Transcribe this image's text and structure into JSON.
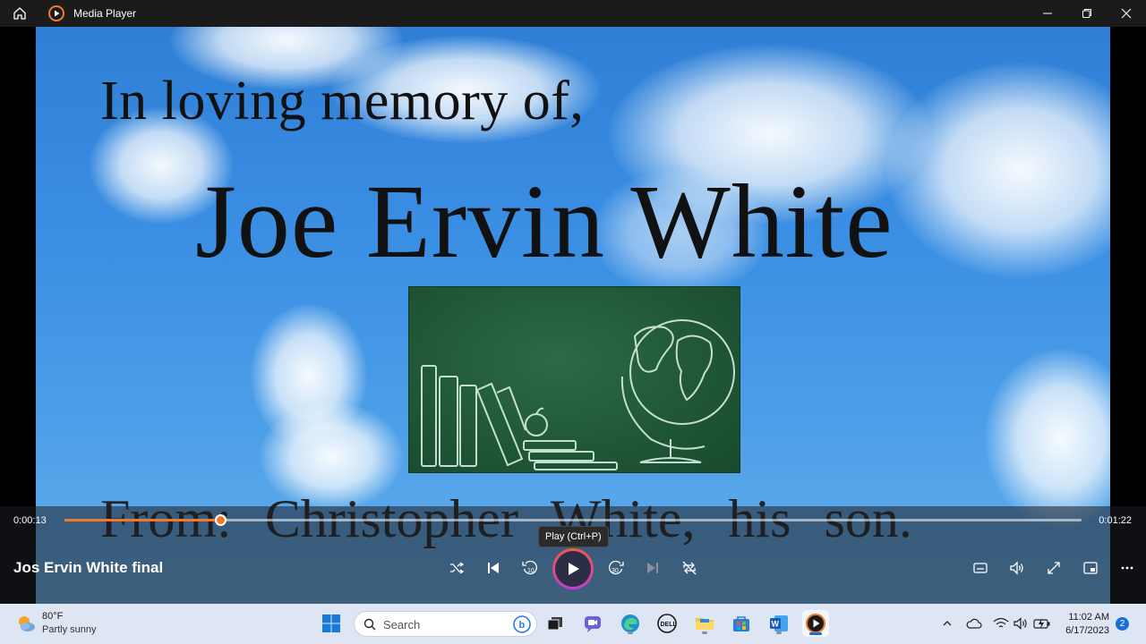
{
  "window": {
    "title": "Media Player"
  },
  "video": {
    "caption_line1": "In loving memory of,",
    "caption_line2": "Joe Ervin White",
    "caption_line3": "From:     Christopher White, his son."
  },
  "playback": {
    "current_time": "0:00:13",
    "total_time": "0:01:22",
    "progress_fraction": 0.153,
    "tooltip": "Play (Ctrl+P)",
    "media_title": "Jos Ervin White final"
  },
  "taskbar": {
    "weather_temp": "80°F",
    "weather_desc": "Partly sunny",
    "search_placeholder": "Search",
    "time": "11:02 AM",
    "date": "6/17/2023",
    "notification_count": "2"
  },
  "colors": {
    "accent": "#f07a2a",
    "taskbar_bg": "#dfe6f3"
  }
}
